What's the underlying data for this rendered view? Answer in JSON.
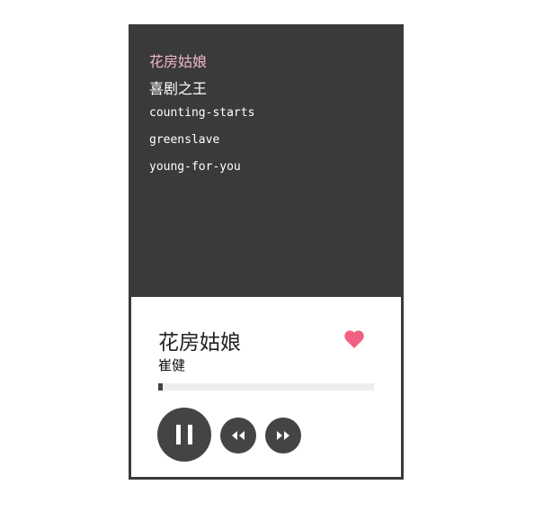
{
  "playlist": {
    "items": [
      {
        "label": "花房姑娘",
        "active": true
      },
      {
        "label": "喜剧之王",
        "active": false
      },
      {
        "label": "counting-starts",
        "active": false
      },
      {
        "label": "greenslave",
        "active": false
      },
      {
        "label": "young-for-you",
        "active": false
      }
    ]
  },
  "now_playing": {
    "title": "花房姑娘",
    "artist": "崔健",
    "liked": true,
    "progress": 0.02
  },
  "controls": {
    "play_pause_icon": "pause-icon",
    "prev_icon": "rewind-icon",
    "next_icon": "fast-forward-icon"
  },
  "colors": {
    "dark_bg": "#3a3a3a",
    "active_item": "#f2b8c6",
    "heart": "#f06080",
    "button": "#444444",
    "track": "#eeeeee"
  }
}
